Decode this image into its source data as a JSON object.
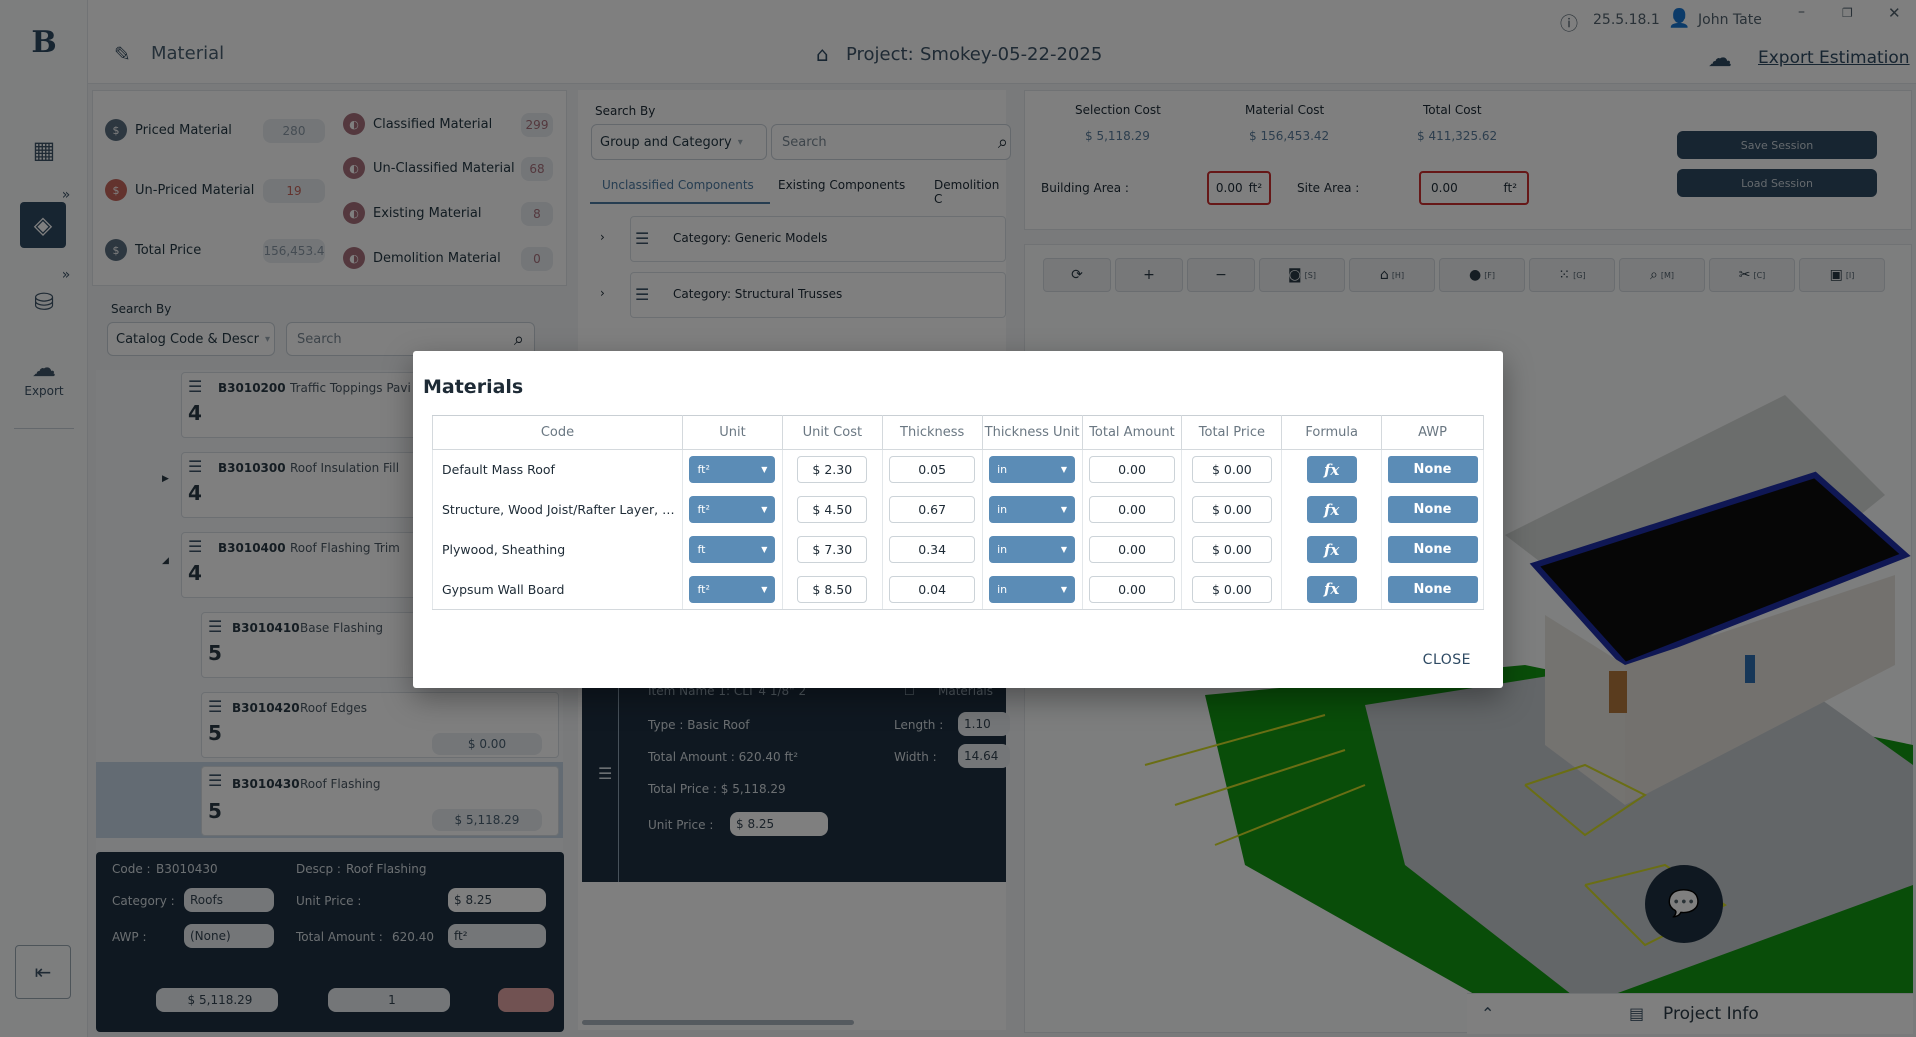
{
  "header": {
    "page_title": "Material",
    "project_label": "Project:",
    "project_name": "Smokey-05-22-2025",
    "version": "25.5.18.1",
    "user": "John Tate",
    "export_label": "Export Estimation"
  },
  "rail": {
    "export_label": "Export"
  },
  "stats": {
    "priced_label": "Priced Material",
    "priced_count": "280",
    "unpriced_label": "Un-Priced Material",
    "unpriced_count": "19",
    "total_price_label": "Total Price",
    "total_price_value": "156,453.4",
    "classified_label": "Classified Material",
    "classified_count": "299",
    "unclassified_label": "Un-Classified Material",
    "unclassified_count": "68",
    "existing_label": "Existing Material",
    "existing_count": "8",
    "demolition_label": "Demolition Material",
    "demolition_count": "0"
  },
  "left_search": {
    "label": "Search By",
    "mode": "Catalog Code & Descr",
    "placeholder": "Search"
  },
  "tree": [
    {
      "code": "B3010200",
      "name": "Traffic Toppings Pavi",
      "level": "4"
    },
    {
      "code": "B3010300",
      "name": "Roof Insulation Fill",
      "level": "4"
    },
    {
      "code": "B3010400",
      "name": "Roof Flashing Trim",
      "level": "4"
    },
    {
      "code": "B3010410",
      "name": "Base Flashing",
      "level": "5"
    },
    {
      "code": "B3010420",
      "name": "Roof Edges",
      "level": "5",
      "price": "$ 0.00"
    },
    {
      "code": "B3010430",
      "name": "Roof Flashing",
      "level": "5",
      "price": "$ 5,118.29"
    }
  ],
  "detail": {
    "code_label": "Code :",
    "code": "B3010430",
    "descp_label": "Descp :",
    "descp": "Roof Flashing",
    "category_label": "Category :",
    "category": "Roofs",
    "unit_price_label": "Unit Price :",
    "unit_price": "$ 8.25",
    "awp_label": "AWP :",
    "awp": "(None)",
    "total_amount_label": "Total Amount :",
    "total_amount": "620.40",
    "unit": "ft²",
    "footer_price": "$ 5,118.29",
    "footer_qty": "1"
  },
  "middle": {
    "search_label": "Search By",
    "mode": "Group and Category",
    "placeholder": "Search",
    "tabs": [
      "Unclassified Components",
      "Existing Components",
      "Demolition C"
    ],
    "categories": [
      "Category:  Generic Models",
      "Category:  Structural Trusses"
    ],
    "item": {
      "name": "Item Name 1: CLT 4 1/8\" 2",
      "materials_label": "Materials",
      "type": "Type :  Basic Roof",
      "total_amount": "Total Amount :  620.40 ft²",
      "total_price": "Total Price : $ 5,118.29",
      "unit_price_label": "Unit Price :",
      "unit_price": "$ 8.25",
      "length_label": "Length :",
      "length": "1.10",
      "width_label": "Width :",
      "width": "14.64"
    }
  },
  "costs": {
    "selection_label": "Selection Cost",
    "selection": "$ 5,118.29",
    "material_label": "Material Cost",
    "material": "$ 156,453.42",
    "total_label": "Total Cost",
    "total": "$ 411,325.62",
    "building_area_label": "Building Area :",
    "building_area": "0.00",
    "site_area_label": "Site Area :",
    "site_area": "0.00",
    "area_unit": "ft²",
    "save_session": "Save Session",
    "load_session": "Load Session"
  },
  "toolbar": {
    "keys": [
      "[S]",
      "[H]",
      "[F]",
      "[G]",
      "[M]",
      "[C]",
      "[I]"
    ]
  },
  "project_info": "Project Info",
  "modal": {
    "title": "Materials",
    "columns": [
      "Code",
      "Unit",
      "Unit Cost",
      "Thickness",
      "Thickness Unit",
      "Total Amount",
      "Total Price",
      "Formula",
      "AWP"
    ],
    "rows": [
      {
        "code": "Default Mass Roof",
        "unit": "ft²",
        "unit_cost": "$ 2.30",
        "thickness": "0.05",
        "thickness_unit": "in",
        "total_amount": "0.00",
        "total_price": "$ 0.00",
        "awp": "None"
      },
      {
        "code": "Structure, Wood Joist/Rafter Layer, Bat...",
        "unit": "ft²",
        "unit_cost": "$ 4.50",
        "thickness": "0.67",
        "thickness_unit": "in",
        "total_amount": "0.00",
        "total_price": "$ 0.00",
        "awp": "None"
      },
      {
        "code": "Plywood, Sheathing",
        "unit": "ft",
        "unit_cost": "$ 7.30",
        "thickness": "0.34",
        "thickness_unit": "in",
        "total_amount": "0.00",
        "total_price": "$ 0.00",
        "awp": "None"
      },
      {
        "code": "Gypsum Wall Board",
        "unit": "ft²",
        "unit_cost": "$ 8.50",
        "thickness": "0.04",
        "thickness_unit": "in",
        "total_amount": "0.00",
        "total_price": "$ 0.00",
        "awp": "None"
      }
    ],
    "formula_glyph": "fx",
    "close_label": "CLOSE"
  }
}
